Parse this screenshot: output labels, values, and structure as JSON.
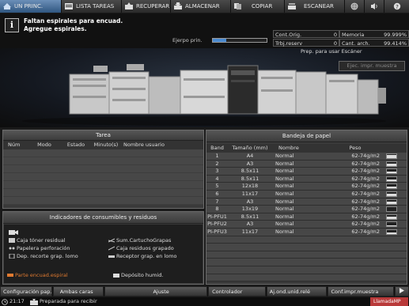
{
  "tabs": [
    {
      "label": "UN PRINC.",
      "icon": "home-icon",
      "active": true
    },
    {
      "label": "LISTA TAREAS",
      "icon": "job-list-icon",
      "active": false
    },
    {
      "label": "RECUPERAR",
      "icon": "recall-icon",
      "active": false
    },
    {
      "label": "ALMACENAR",
      "icon": "store-icon",
      "active": false
    },
    {
      "label": "COPIAR",
      "icon": "copy-icon",
      "active": false
    },
    {
      "label": "ESCANEAR",
      "icon": "scan-icon",
      "active": false
    }
  ],
  "tab_icons": [
    "globe-icon",
    "speaker-icon",
    "help-icon"
  ],
  "message": {
    "line1": "Faltan espirales para encuad.",
    "line2": "Agregue espirales."
  },
  "busy": {
    "label": "Ejerpo prin.",
    "progress": 0.25
  },
  "counters": {
    "orig_label": "Cont.Orig.",
    "orig_value": "0",
    "reserv_label": "Trbj.reserv",
    "reserv_value": "0",
    "memory_label": "Memoria",
    "memory_value": "99.999%",
    "store_label": "Cant. arch.",
    "store_value": "99.414%"
  },
  "scan_status": "Prep. para usar Escáner",
  "print_exec_button": "Ejec. impr. muestra",
  "job_panel": {
    "title": "Tarea",
    "columns": [
      "Núm",
      "Modo",
      "Estado",
      "Minuto(s)",
      "Nombre usuario"
    ]
  },
  "consumables": {
    "title": "Indicadores de consumibles y residuos",
    "items": [
      {
        "label": "Caja tóner residual",
        "icon": "toner-waste-icon"
      },
      {
        "label": "Sum.CartuchoGrapas",
        "icon": "staple-cartridge-icon"
      },
      {
        "label": "Papelera perforación",
        "icon": "punch-waste-icon"
      },
      {
        "label": "Caja residuos grapado",
        "icon": "staple-waste-icon"
      },
      {
        "label": "Dep. recorte grap. lomo",
        "icon": "trim-waste-icon"
      },
      {
        "label": "Receptor grap. en lomo",
        "icon": "spine-receiver-icon"
      },
      {
        "label": "Parte encuad.espiral",
        "icon": "coil-binding-icon"
      },
      {
        "label": "Depósito humid.",
        "icon": "humidifier-tank-icon"
      }
    ]
  },
  "tray_panel": {
    "title": "Bandeja de papel",
    "columns": [
      "Band",
      "Tamaño (mm)",
      "Nombre",
      "Peso"
    ],
    "rows": [
      {
        "band": "1",
        "size": "A4",
        "name": "Normal",
        "weight": "62-74g/m2",
        "level": 0.9
      },
      {
        "band": "2",
        "size": "A3",
        "name": "Normal",
        "weight": "62-74g/m2",
        "level": 0.5
      },
      {
        "band": "3",
        "size": "8.5x11",
        "name": "Normal",
        "weight": "62-74g/m2",
        "level": 0.5
      },
      {
        "band": "4",
        "size": "8.5x11",
        "name": "Normal",
        "weight": "62-74g/m2",
        "level": 0.4
      },
      {
        "band": "5",
        "size": "12x18",
        "name": "Normal",
        "weight": "62-74g/m2",
        "level": 0.5
      },
      {
        "band": "6",
        "size": "11x17",
        "name": "Normal",
        "weight": "62-74g/m2",
        "level": 0.5
      },
      {
        "band": "7",
        "size": "A3",
        "name": "Normal",
        "weight": "62-74g/m2",
        "level": 0.5
      },
      {
        "band": "8",
        "size": "13x19",
        "name": "Normal",
        "weight": "62-74g/m2",
        "level": 0.0
      },
      {
        "band": "PI-PFU1",
        "size": "8.5x11",
        "name": "Normal",
        "weight": "62-74g/m2",
        "level": 0.5
      },
      {
        "band": "PI-PFU2",
        "size": "A3",
        "name": "Normal",
        "weight": "62-74g/m2",
        "level": 0.3
      },
      {
        "band": "PI-PFU3",
        "size": "11x17",
        "name": "Normal",
        "weight": "62-74g/m2",
        "level": 0.3
      }
    ]
  },
  "bottom_buttons": [
    "Configuración pap.",
    "Ambas caras",
    "Ajuste",
    "Controlador",
    "Aj.ond.unid.relé",
    "Conf.impr.muestra"
  ],
  "status_bar": {
    "time": "21:17",
    "text": "Preparada para recibir",
    "call_label": "LlamadaMP"
  },
  "colors": {
    "active_tab": "#2f5680",
    "call_button": "#b93a3a",
    "busy_fill": "#4a8ad0"
  }
}
